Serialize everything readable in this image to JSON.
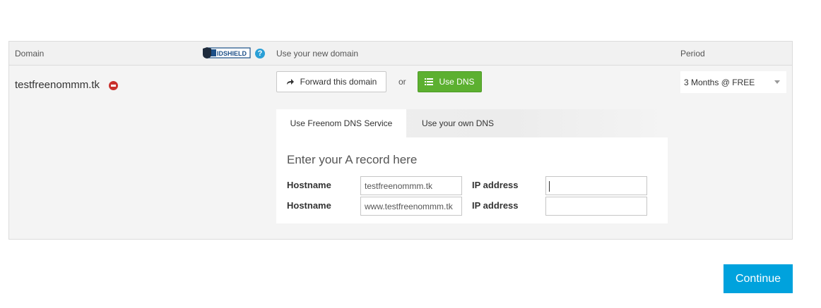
{
  "header": {
    "domain_col": "Domain",
    "idshield_label": "IDSHIELD",
    "new_domain_col": "Use your new domain",
    "period_col": "Period"
  },
  "row": {
    "domain": "testfreenommm.tk",
    "forward_button": "Forward this domain",
    "or_text": "or",
    "dns_button": "Use DNS",
    "period_value": "3 Months @ FREE"
  },
  "tabs": [
    {
      "label": "Use Freenom DNS Service",
      "active": true
    },
    {
      "label": "Use your own DNS",
      "active": false
    }
  ],
  "record": {
    "title": "Enter your A record here",
    "rows": [
      {
        "hostname_label": "Hostname",
        "hostname_value": "testfreenommm.tk",
        "ip_label": "IP address",
        "ip_value": ""
      },
      {
        "hostname_label": "Hostname",
        "hostname_value": "www.testfreenommm.tk",
        "ip_label": "IP address",
        "ip_value": ""
      }
    ]
  },
  "continue_button": "Continue",
  "colors": {
    "green": "#5cb030",
    "continue_blue": "#00a2dd",
    "help_blue": "#2a9fd6",
    "remove_red": "#c9302c"
  },
  "icons": [
    "idshield-logo-icon",
    "help-icon",
    "remove-icon",
    "forward-arrow-icon",
    "list-icon",
    "chevron-down-icon"
  ]
}
